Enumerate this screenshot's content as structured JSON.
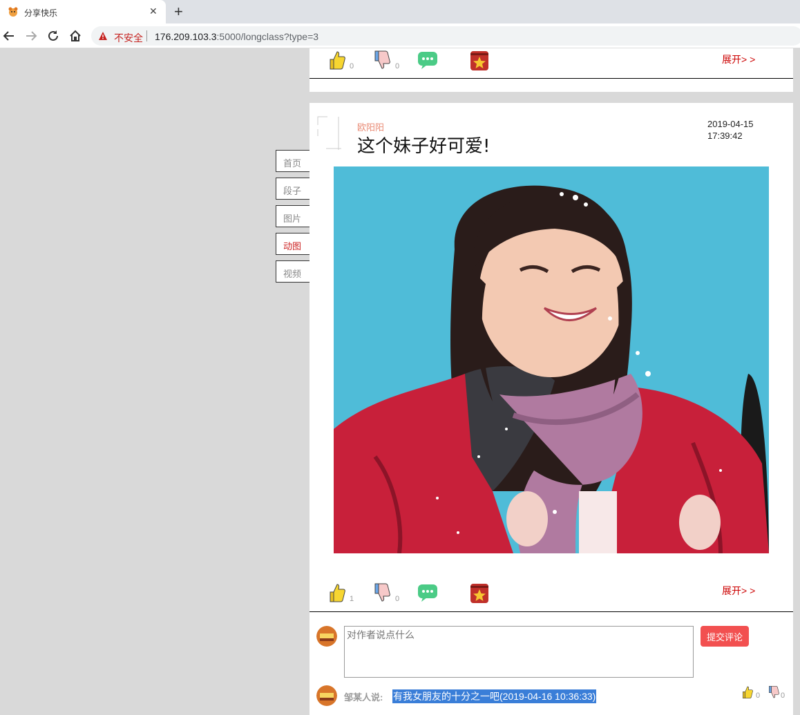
{
  "browser": {
    "tab_title": "分享快乐",
    "insecure_label": "不安全",
    "url_host": "176.209.103.3",
    "url_path": ":5000/longclass?type=3"
  },
  "sidenav": [
    {
      "label": "首页",
      "active": false
    },
    {
      "label": "段子",
      "active": false
    },
    {
      "label": "图片",
      "active": false
    },
    {
      "label": "动图",
      "active": true
    },
    {
      "label": "视频",
      "active": false
    }
  ],
  "prev_post": {
    "likes": "0",
    "dislikes": "0",
    "expand_label": "展开> >"
  },
  "post": {
    "author": "欧阳阳",
    "title": "这个妹子好可爱!",
    "date_line1": "2019-04-15",
    "date_line2": "17:39:42",
    "likes": "1",
    "dislikes": "0",
    "expand_label": "展开> >",
    "comment_placeholder": "对作者说点什么",
    "submit_label": "提交评论"
  },
  "comment": {
    "user": "邹某人说:",
    "text": "有我女朋友的十分之一吧(2019-04-16 10:36:33)",
    "likes": "0",
    "dislikes": "0"
  },
  "icons": {
    "like": "thumbs-up-icon",
    "dislike": "thumbs-down-icon",
    "comment": "chat-bubble-icon",
    "favorite": "star-badge-icon"
  },
  "colors": {
    "accent_red": "#cc2222",
    "submit": "#f25050",
    "author": "#e98a74",
    "selection": "#3a7ed8"
  }
}
